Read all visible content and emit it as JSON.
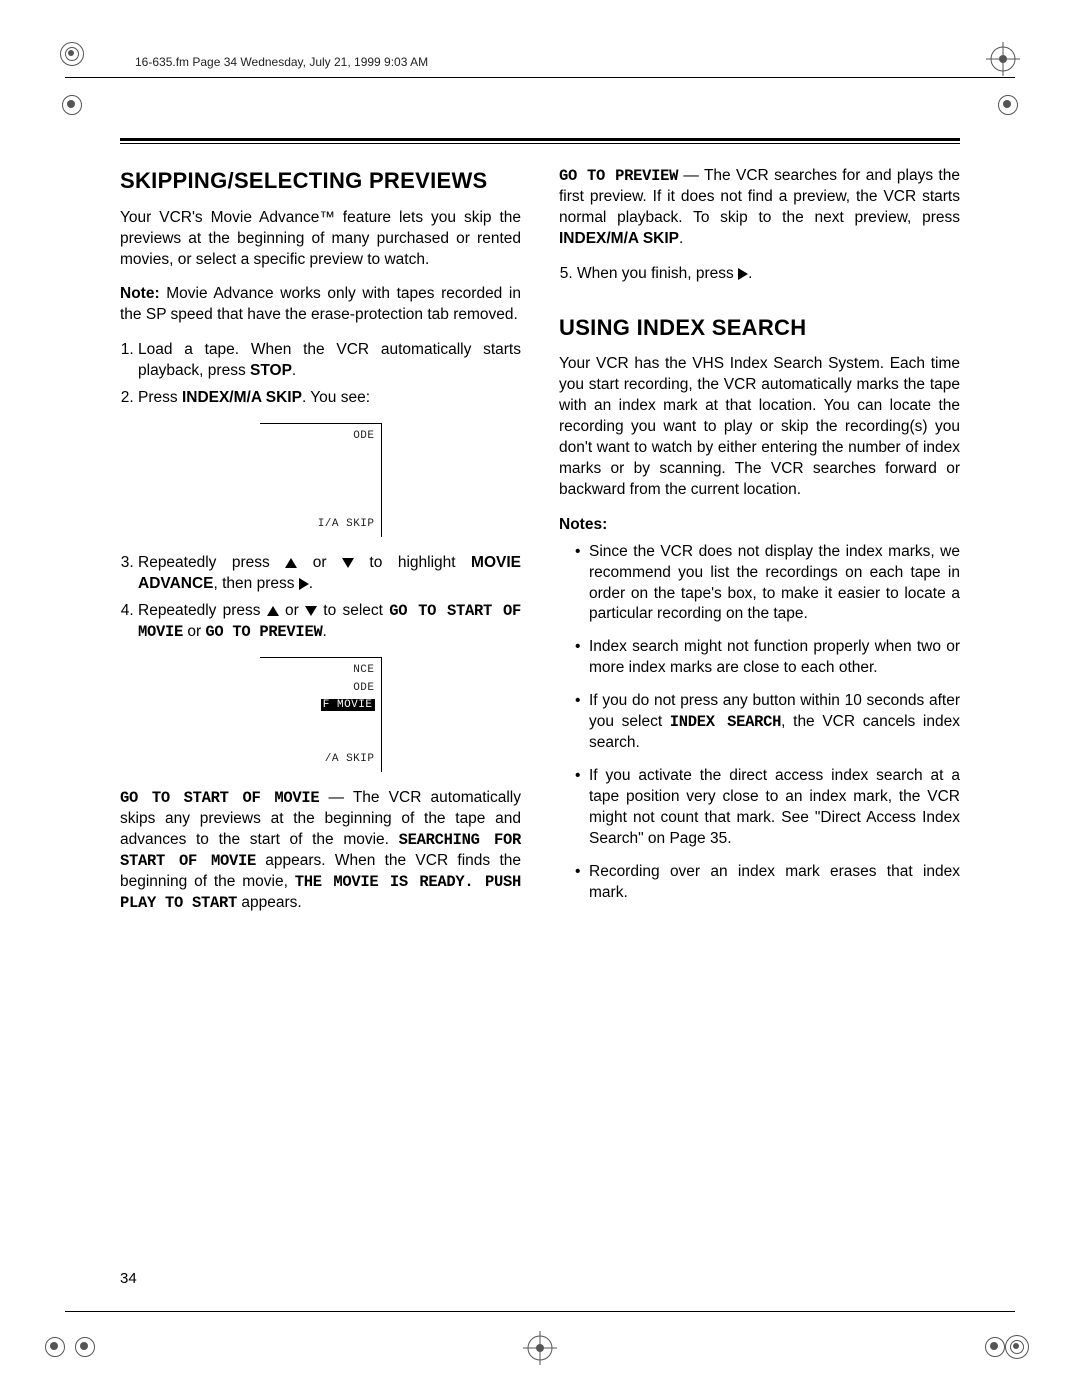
{
  "header_line": "16-635.fm  Page 34  Wednesday, July 21, 1999  9:03 AM",
  "page_number": "34",
  "left": {
    "h1": "SKIPPING/SELECTING PREVIEWS",
    "intro": "Your VCR's Movie Advance™ feature lets you skip the previews at the beginning of many purchased or rented movies, or select a specific preview to watch.",
    "note_label": "Note:",
    "note": " Movie Advance works only with tapes recorded in the SP speed that have the erase-protection tab removed.",
    "step1a": "Load a tape. When the VCR automatically starts playback, press ",
    "step1b": "STOP",
    "step1c": ".",
    "step2a": "Press ",
    "step2b": "INDEX/M/A SKIP",
    "step2c": ". You see:",
    "screen1_l1": "ODE",
    "screen1_l2": "I/A SKIP",
    "step3a": "Repeatedly press ",
    "step3b": " or ",
    "step3c": " to highlight ",
    "step3d": "MOVIE ADVANCE",
    "step3e": ", then press ",
    "step3f": ".",
    "step4a": "Repeatedly press ",
    "step4b": " or ",
    "step4c": " to select ",
    "step4d": "GO TO START OF MOVIE",
    "step4e": " or ",
    "step4f": "GO TO PREVIEW",
    "step4g": ".",
    "screen2_l1": "NCE",
    "screen2_l2": "ODE",
    "screen2_l3": "F MOVIE",
    "screen2_l4": "/A SKIP",
    "sm_label": "GO TO START OF MOVIE",
    "sm_a": " — The VCR automatically skips any previews at the beginning of the tape and advances to the start of the movie. ",
    "sm_b": "SEARCHING FOR START OF MOVIE",
    "sm_c": " appears. When the VCR finds the beginning of the movie, ",
    "sm_d": "THE MOVIE IS READY. PUSH PLAY TO START",
    "sm_e": " appears."
  },
  "right": {
    "pv_label": "GO TO PREVIEW",
    "pv_a": " — The VCR searches for and plays the first preview. If it does not find a preview, the VCR starts normal playback. To skip to the next preview, press ",
    "pv_b": "INDEX/M/A SKIP",
    "pv_c": ".",
    "step5a": "When you finish, press ",
    "step5b": ".",
    "h2": "USING INDEX SEARCH",
    "intro": "Your VCR has the VHS Index Search System. Each time you start recording, the VCR automatically marks the tape with an index mark at that location. You can locate the recording you want to play or skip the recording(s) you don't want to watch by either entering the number of index marks or by scanning. The VCR searches forward or backward from the current location.",
    "notes_label": "Notes:",
    "n1": "Since the VCR does not display the index marks, we recommend you list the recordings on each tape in order on the tape's box, to make it easier to locate a particular recording on the tape.",
    "n2": "Index search might not function properly when two or more index marks are close to each other.",
    "n3a": "If you do not press any button within 10 seconds after you select ",
    "n3b": "INDEX SEARCH",
    "n3c": ", the VCR cancels index search.",
    "n4": "If you activate the direct access index search at a tape position very close to an index mark, the VCR might not count that mark. See \"Direct Access Index Search\" on Page 35.",
    "n5": "Recording over an index mark erases that index mark."
  }
}
